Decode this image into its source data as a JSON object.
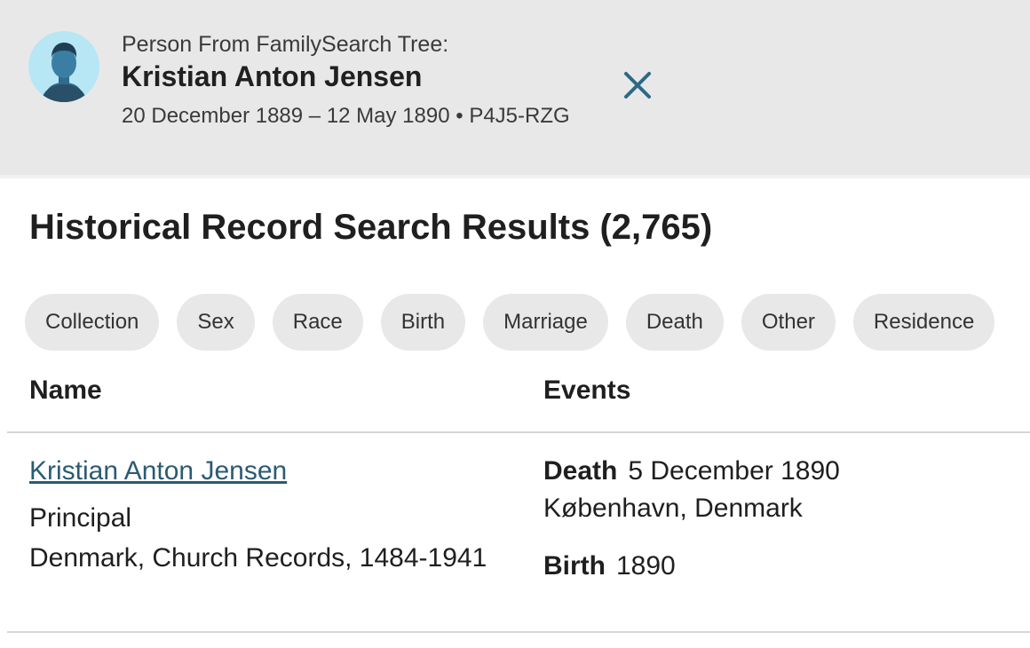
{
  "person": {
    "label": "Person From FamilySearch Tree:",
    "name": "Kristian Anton Jensen",
    "dates": "20 December 1889 – 12 May 1890",
    "separator": "•",
    "id": "P4J5-RZG",
    "avatar_icon": "person-avatar-icon",
    "close_icon": "close-icon"
  },
  "results": {
    "title": "Historical Record Search Results (2,765)"
  },
  "filters": [
    "Collection",
    "Sex",
    "Race",
    "Birth",
    "Marriage",
    "Death",
    "Other",
    "Residence"
  ],
  "table": {
    "headers": {
      "name": "Name",
      "events": "Events"
    },
    "rows": [
      {
        "name": "Kristian Anton Jensen",
        "role": "Principal",
        "collection": "Denmark, Church Records, 1484-1941",
        "events": [
          {
            "type": "Death",
            "date": "5 December 1890",
            "place": "København, Denmark"
          },
          {
            "type": "Birth",
            "date": "1890"
          }
        ]
      }
    ]
  },
  "colors": {
    "header_bg": "#e8e8e9",
    "link": "#2b5b74",
    "close_icon": "#2b6a86",
    "avatar_bg": "#b7e6f4",
    "avatar_figure": "#2f6b8a"
  }
}
